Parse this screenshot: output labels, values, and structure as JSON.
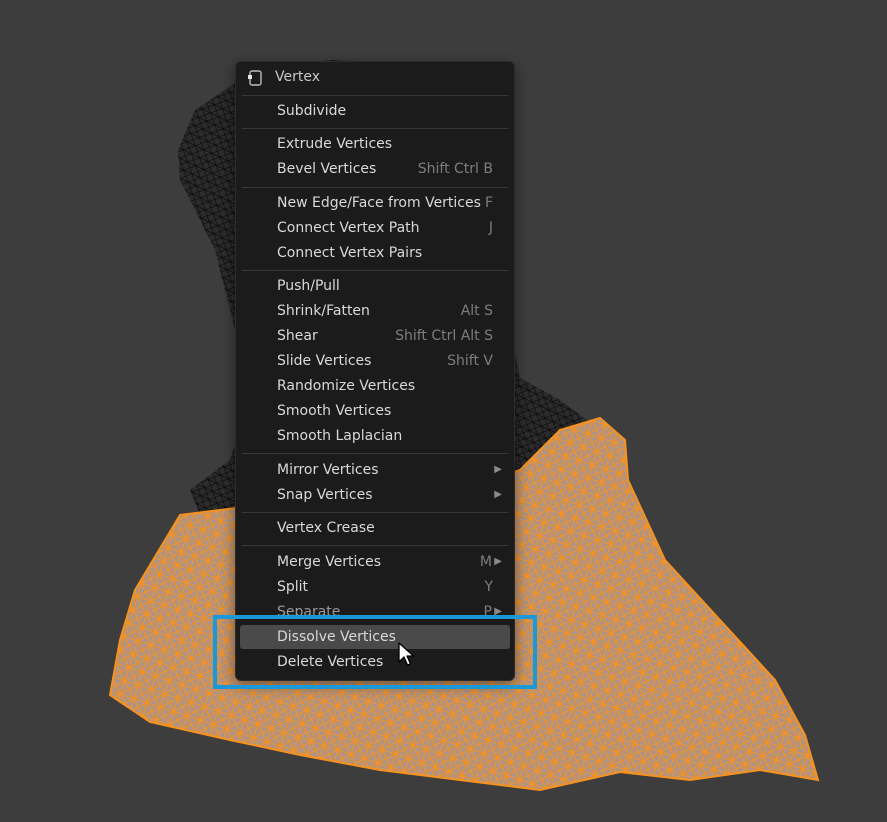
{
  "menu": {
    "title": "Vertex",
    "items": [
      {
        "label": "Subdivide",
        "shortcut": "",
        "submenu": false
      },
      {
        "label": "Extrude Vertices",
        "shortcut": "",
        "submenu": false
      },
      {
        "label": "Bevel Vertices",
        "shortcut": "Shift Ctrl B",
        "submenu": false
      },
      {
        "label": "New Edge/Face from Vertices",
        "shortcut": "F",
        "submenu": false
      },
      {
        "label": "Connect Vertex Path",
        "shortcut": "J",
        "submenu": false
      },
      {
        "label": "Connect Vertex Pairs",
        "shortcut": "",
        "submenu": false
      },
      {
        "label": "Push/Pull",
        "shortcut": "",
        "submenu": false
      },
      {
        "label": "Shrink/Fatten",
        "shortcut": "Alt S",
        "submenu": false
      },
      {
        "label": "Shear",
        "shortcut": "Shift Ctrl Alt S",
        "submenu": false
      },
      {
        "label": "Slide Vertices",
        "shortcut": "Shift V",
        "submenu": false
      },
      {
        "label": "Randomize Vertices",
        "shortcut": "",
        "submenu": false
      },
      {
        "label": "Smooth Vertices",
        "shortcut": "",
        "submenu": false
      },
      {
        "label": "Smooth Laplacian",
        "shortcut": "",
        "submenu": false
      },
      {
        "label": "Mirror Vertices",
        "shortcut": "",
        "submenu": true
      },
      {
        "label": "Snap Vertices",
        "shortcut": "",
        "submenu": true
      },
      {
        "label": "Vertex Crease",
        "shortcut": "",
        "submenu": false
      },
      {
        "label": "Merge Vertices",
        "shortcut": "M",
        "submenu": true
      },
      {
        "label": "Split",
        "shortcut": "Y",
        "submenu": false
      },
      {
        "label": "Separate",
        "shortcut": "P",
        "submenu": true
      },
      {
        "label": "Dissolve Vertices",
        "shortcut": "",
        "submenu": false,
        "active": true
      },
      {
        "label": "Delete Vertices",
        "shortcut": "",
        "submenu": false
      }
    ]
  },
  "colors": {
    "viewport_bg": "#3d3d3d",
    "menu_bg": "#1b1b1b",
    "selected_mesh": "#f7921e",
    "unselected_mesh": "#111111",
    "highlight_box": "#1d98d6"
  },
  "icons": {
    "header_icon": "vertex-mode-icon",
    "cursor": "mouse-pointer-icon"
  }
}
